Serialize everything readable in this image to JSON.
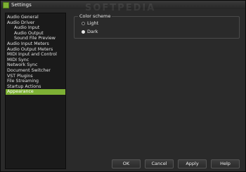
{
  "window": {
    "title": "Settings"
  },
  "watermark": "SOFTPEDIA",
  "sidebar": {
    "items": [
      {
        "label": "Audio General",
        "level": 0,
        "selected": false
      },
      {
        "label": "Audio Driver",
        "level": 0,
        "selected": false
      },
      {
        "label": "Audio Input",
        "level": 1,
        "selected": false
      },
      {
        "label": "Audio Output",
        "level": 1,
        "selected": false
      },
      {
        "label": "Sound File Preview",
        "level": 1,
        "selected": false
      },
      {
        "label": "Audio Input Meters",
        "level": 0,
        "selected": false
      },
      {
        "label": "Audio Output Meters",
        "level": 0,
        "selected": false
      },
      {
        "label": "MIDI Input and Control",
        "level": 0,
        "selected": false
      },
      {
        "label": "MIDI Sync",
        "level": 0,
        "selected": false
      },
      {
        "label": "Network Sync",
        "level": 0,
        "selected": false
      },
      {
        "label": "Document Switcher",
        "level": 0,
        "selected": false
      },
      {
        "label": "VST Plugins",
        "level": 0,
        "selected": false
      },
      {
        "label": "File Streaming",
        "level": 0,
        "selected": false
      },
      {
        "label": "Startup Actions",
        "level": 0,
        "selected": false
      },
      {
        "label": "Appearance",
        "level": 0,
        "selected": true
      }
    ]
  },
  "appearance": {
    "group_title": "Color scheme",
    "options": [
      {
        "label": "Light",
        "checked": false
      },
      {
        "label": "Dark",
        "checked": true
      }
    ]
  },
  "buttons": {
    "ok": "OK",
    "cancel": "Cancel",
    "apply": "Apply",
    "help": "Help"
  },
  "colors": {
    "accent": "#7db034",
    "background": "#2a2a2a",
    "panel": "#1a1a1a"
  }
}
